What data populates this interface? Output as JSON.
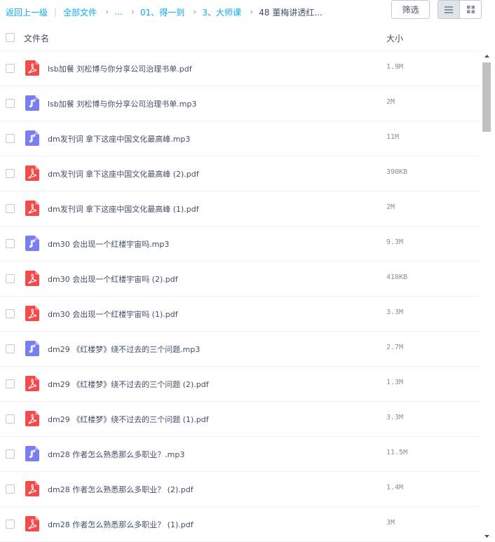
{
  "toolbar": {
    "back_label": "返回上一级",
    "all_files_label": "全部文件",
    "ellipsis_label": "...",
    "crumb_1": "01、得一到",
    "crumb_2": "3、大师课",
    "crumb_current": "48 董梅讲透红...",
    "filter_label": "筛选",
    "view_mode": "list"
  },
  "columns": {
    "name": "文件名",
    "size": "大小"
  },
  "colors": {
    "pdf": "#f24b4b",
    "audio": "#7a7ff0",
    "link": "#09aaff"
  },
  "files": [
    {
      "name": "lsb加餐 刘松博与你分享公司治理书单.pdf",
      "size": "1.9M",
      "type": "pdf"
    },
    {
      "name": "lsb加餐 刘松博与你分享公司治理书单.mp3",
      "size": "2M",
      "type": "audio"
    },
    {
      "name": "dm发刊词 拿下这座中国文化最高峰.mp3",
      "size": "11M",
      "type": "audio"
    },
    {
      "name": "dm发刊词 拿下这座中国文化最高峰 (2).pdf",
      "size": "390KB",
      "type": "pdf"
    },
    {
      "name": "dm发刊词 拿下这座中国文化最高峰 (1).pdf",
      "size": "2M",
      "type": "pdf"
    },
    {
      "name": "dm30 会出现一个红楼宇宙吗.mp3",
      "size": "9.3M",
      "type": "audio"
    },
    {
      "name": "dm30 会出现一个红楼宇宙吗 (2).pdf",
      "size": "410KB",
      "type": "pdf"
    },
    {
      "name": "dm30 会出现一个红楼宇宙吗 (1).pdf",
      "size": "3.3M",
      "type": "pdf"
    },
    {
      "name": "dm29 《红楼梦》绕不过去的三个问题.mp3",
      "size": "2.7M",
      "type": "audio"
    },
    {
      "name": "dm29 《红楼梦》绕不过去的三个问题 (2).pdf",
      "size": "1.3M",
      "type": "pdf"
    },
    {
      "name": "dm29 《红楼梦》绕不过去的三个问题 (1).pdf",
      "size": "3.3M",
      "type": "pdf"
    },
    {
      "name": "dm28 作者怎么熟悉那么多职业？.mp3",
      "size": "11.5M",
      "type": "audio"
    },
    {
      "name": "dm28 作者怎么熟悉那么多职业？ (2).pdf",
      "size": "1.4M",
      "type": "pdf"
    },
    {
      "name": "dm28 作者怎么熟悉那么多职业？ (1).pdf",
      "size": "3M",
      "type": "pdf"
    }
  ]
}
